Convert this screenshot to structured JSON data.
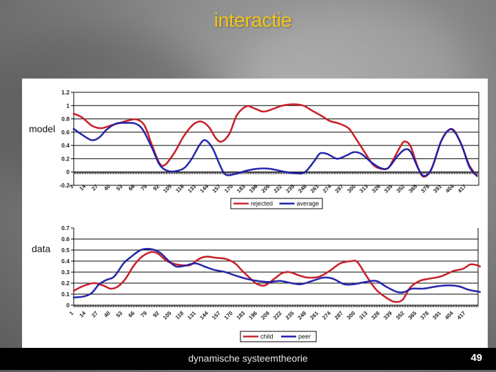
{
  "slide": {
    "title": "interactie",
    "footer_text": "dynamische systeemtheorie",
    "page_number": "49",
    "side_labels": {
      "top": "model",
      "bottom": "data"
    }
  },
  "colors": {
    "title": "#f0c419",
    "series_red": "#c8202a",
    "series_blue": "#1c1ca8"
  },
  "chart_data": [
    {
      "type": "line",
      "name": "model",
      "title": "",
      "xlabel": "",
      "ylabel": "",
      "xlim": [
        1,
        430
      ],
      "ylim": [
        -0.2,
        1.2
      ],
      "yticks": [
        -0.2,
        0,
        0.2,
        0.4,
        0.6,
        0.8,
        1,
        1.2
      ],
      "ytick_labels": [
        "-0.2",
        "0",
        "0.2",
        "0.4",
        "0.6",
        "0.8",
        "1",
        "1.2"
      ],
      "xticks": [
        1,
        14,
        27,
        40,
        53,
        66,
        79,
        92,
        105,
        118,
        131,
        144,
        157,
        170,
        183,
        196,
        209,
        222,
        235,
        248,
        261,
        274,
        287,
        300,
        313,
        326,
        339,
        352,
        365,
        378,
        391,
        404,
        417
      ],
      "grid": true,
      "legend": {
        "position": "bottom-right",
        "entries": [
          "rejected",
          "average"
        ]
      },
      "series": [
        {
          "name": "rejected",
          "color": "#c8202a",
          "points": [
            [
              1,
              0.88
            ],
            [
              10,
              0.82
            ],
            [
              20,
              0.7
            ],
            [
              30,
              0.66
            ],
            [
              40,
              0.7
            ],
            [
              50,
              0.74
            ],
            [
              60,
              0.78
            ],
            [
              68,
              0.79
            ],
            [
              76,
              0.7
            ],
            [
              84,
              0.4
            ],
            [
              92,
              0.13
            ],
            [
              98,
              0.11
            ],
            [
              108,
              0.3
            ],
            [
              118,
              0.55
            ],
            [
              128,
              0.72
            ],
            [
              136,
              0.76
            ],
            [
              144,
              0.68
            ],
            [
              152,
              0.5
            ],
            [
              158,
              0.46
            ],
            [
              166,
              0.58
            ],
            [
              174,
              0.86
            ],
            [
              184,
              0.99
            ],
            [
              192,
              0.96
            ],
            [
              202,
              0.91
            ],
            [
              212,
              0.95
            ],
            [
              222,
              1.0
            ],
            [
              234,
              1.02
            ],
            [
              244,
              1.0
            ],
            [
              254,
              0.92
            ],
            [
              264,
              0.84
            ],
            [
              272,
              0.77
            ],
            [
              282,
              0.73
            ],
            [
              292,
              0.66
            ],
            [
              300,
              0.5
            ],
            [
              310,
              0.28
            ],
            [
              318,
              0.11
            ],
            [
              326,
              0.05
            ],
            [
              334,
              0.06
            ],
            [
              340,
              0.2
            ],
            [
              348,
              0.41
            ],
            [
              352,
              0.46
            ],
            [
              358,
              0.38
            ],
            [
              366,
              0.05
            ],
            [
              372,
              -0.07
            ],
            [
              380,
              0.05
            ],
            [
              390,
              0.46
            ],
            [
              398,
              0.63
            ],
            [
              404,
              0.62
            ],
            [
              412,
              0.4
            ],
            [
              420,
              0.1
            ],
            [
              428,
              -0.05
            ]
          ]
        },
        {
          "name": "average",
          "color": "#1c1ca8",
          "points": [
            [
              1,
              0.65
            ],
            [
              10,
              0.56
            ],
            [
              20,
              0.48
            ],
            [
              28,
              0.52
            ],
            [
              36,
              0.64
            ],
            [
              46,
              0.73
            ],
            [
              56,
              0.74
            ],
            [
              66,
              0.73
            ],
            [
              74,
              0.64
            ],
            [
              84,
              0.36
            ],
            [
              92,
              0.11
            ],
            [
              100,
              0.02
            ],
            [
              108,
              0.01
            ],
            [
              118,
              0.06
            ],
            [
              126,
              0.2
            ],
            [
              134,
              0.4
            ],
            [
              140,
              0.48
            ],
            [
              148,
              0.36
            ],
            [
              156,
              0.1
            ],
            [
              162,
              -0.04
            ],
            [
              172,
              -0.03
            ],
            [
              184,
              0.02
            ],
            [
              196,
              0.05
            ],
            [
              208,
              0.05
            ],
            [
              222,
              0.01
            ],
            [
              236,
              -0.02
            ],
            [
              246,
              0.0
            ],
            [
              256,
              0.17
            ],
            [
              262,
              0.28
            ],
            [
              270,
              0.27
            ],
            [
              280,
              0.2
            ],
            [
              290,
              0.25
            ],
            [
              298,
              0.3
            ],
            [
              306,
              0.27
            ],
            [
              316,
              0.15
            ],
            [
              326,
              0.06
            ],
            [
              334,
              0.06
            ],
            [
              344,
              0.24
            ],
            [
              352,
              0.34
            ],
            [
              358,
              0.3
            ],
            [
              366,
              0.05
            ],
            [
              372,
              -0.06
            ],
            [
              380,
              0.05
            ],
            [
              390,
              0.46
            ],
            [
              398,
              0.63
            ],
            [
              404,
              0.61
            ],
            [
              412,
              0.4
            ],
            [
              420,
              0.08
            ],
            [
              428,
              -0.06
            ]
          ]
        }
      ]
    },
    {
      "type": "line",
      "name": "data",
      "title": "",
      "xlabel": "",
      "ylabel": "",
      "xlim": [
        1,
        430
      ],
      "ylim": [
        0,
        0.7
      ],
      "yticks": [
        0,
        0.1,
        0.2,
        0.3,
        0.4,
        0.5,
        0.6,
        0.7
      ],
      "ytick_labels": [
        "0",
        "0.1",
        "0.2",
        "0.3",
        "0.4",
        "0.5",
        "0.6",
        "0.7"
      ],
      "xticks": [
        1,
        14,
        27,
        40,
        53,
        66,
        79,
        92,
        105,
        118,
        131,
        144,
        157,
        170,
        183,
        196,
        209,
        222,
        235,
        248,
        261,
        274,
        287,
        300,
        313,
        326,
        339,
        352,
        365,
        378,
        391,
        404,
        417
      ],
      "grid": true,
      "legend": {
        "position": "bottom-right",
        "entries": [
          "child",
          "peer"
        ]
      },
      "series": [
        {
          "name": "child",
          "color": "#c8202a",
          "points": [
            [
              1,
              0.13
            ],
            [
              10,
              0.17
            ],
            [
              22,
              0.2
            ],
            [
              32,
              0.18
            ],
            [
              40,
              0.15
            ],
            [
              48,
              0.17
            ],
            [
              56,
              0.24
            ],
            [
              64,
              0.35
            ],
            [
              72,
              0.43
            ],
            [
              82,
              0.48
            ],
            [
              90,
              0.47
            ],
            [
              100,
              0.4
            ],
            [
              110,
              0.37
            ],
            [
              120,
              0.36
            ],
            [
              126,
              0.37
            ],
            [
              134,
              0.42
            ],
            [
              142,
              0.44
            ],
            [
              152,
              0.43
            ],
            [
              162,
              0.42
            ],
            [
              172,
              0.38
            ],
            [
              180,
              0.31
            ],
            [
              190,
              0.23
            ],
            [
              196,
              0.19
            ],
            [
              204,
              0.18
            ],
            [
              214,
              0.24
            ],
            [
              222,
              0.29
            ],
            [
              230,
              0.3
            ],
            [
              240,
              0.27
            ],
            [
              250,
              0.25
            ],
            [
              262,
              0.26
            ],
            [
              274,
              0.32
            ],
            [
              284,
              0.38
            ],
            [
              296,
              0.4
            ],
            [
              302,
              0.39
            ],
            [
              312,
              0.26
            ],
            [
              322,
              0.14
            ],
            [
              334,
              0.06
            ],
            [
              342,
              0.03
            ],
            [
              350,
              0.05
            ],
            [
              358,
              0.16
            ],
            [
              368,
              0.22
            ],
            [
              378,
              0.24
            ],
            [
              390,
              0.26
            ],
            [
              404,
              0.31
            ],
            [
              414,
              0.33
            ],
            [
              422,
              0.37
            ],
            [
              430,
              0.36
            ],
            [
              432,
              0.35
            ]
          ]
        },
        {
          "name": "peer",
          "color": "#1c1ca8",
          "points": [
            [
              1,
              0.07
            ],
            [
              12,
              0.08
            ],
            [
              20,
              0.11
            ],
            [
              28,
              0.19
            ],
            [
              36,
              0.23
            ],
            [
              44,
              0.26
            ],
            [
              54,
              0.38
            ],
            [
              62,
              0.44
            ],
            [
              72,
              0.5
            ],
            [
              82,
              0.51
            ],
            [
              92,
              0.48
            ],
            [
              102,
              0.4
            ],
            [
              110,
              0.35
            ],
            [
              120,
              0.36
            ],
            [
              130,
              0.38
            ],
            [
              140,
              0.35
            ],
            [
              150,
              0.32
            ],
            [
              162,
              0.3
            ],
            [
              172,
              0.27
            ],
            [
              184,
              0.24
            ],
            [
              196,
              0.22
            ],
            [
              208,
              0.21
            ],
            [
              220,
              0.22
            ],
            [
              232,
              0.2
            ],
            [
              242,
              0.19
            ],
            [
              254,
              0.22
            ],
            [
              266,
              0.25
            ],
            [
              276,
              0.24
            ],
            [
              288,
              0.19
            ],
            [
              298,
              0.19
            ],
            [
              310,
              0.21
            ],
            [
              322,
              0.22
            ],
            [
              332,
              0.17
            ],
            [
              344,
              0.12
            ],
            [
              352,
              0.12
            ],
            [
              360,
              0.15
            ],
            [
              372,
              0.15
            ],
            [
              386,
              0.17
            ],
            [
              398,
              0.18
            ],
            [
              410,
              0.17
            ],
            [
              420,
              0.14
            ],
            [
              432,
              0.12
            ]
          ]
        }
      ]
    }
  ]
}
